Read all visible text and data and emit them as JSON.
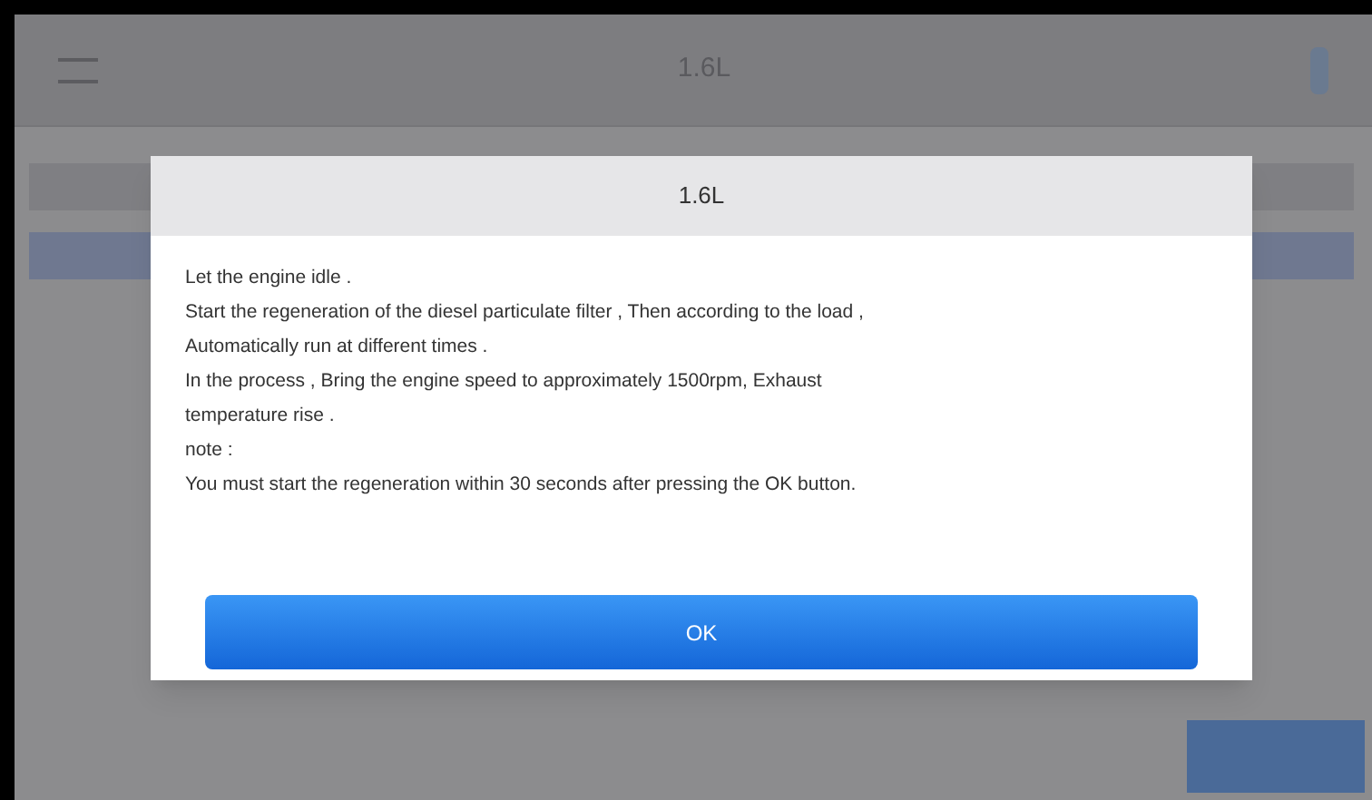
{
  "header": {
    "title": "1.6L"
  },
  "dialog": {
    "title": "1.6L",
    "lines": [
      "Let the engine idle .",
      "Start the regeneration of the diesel particulate filter , Then according to the load ,",
      "Automatically run at different times .",
      "In the process , Bring the engine speed to approximately 1500rpm, Exhaust",
      "temperature rise .",
      "note :",
      "You must start the regeneration within 30 seconds after pressing the OK button."
    ],
    "button": "OK"
  }
}
